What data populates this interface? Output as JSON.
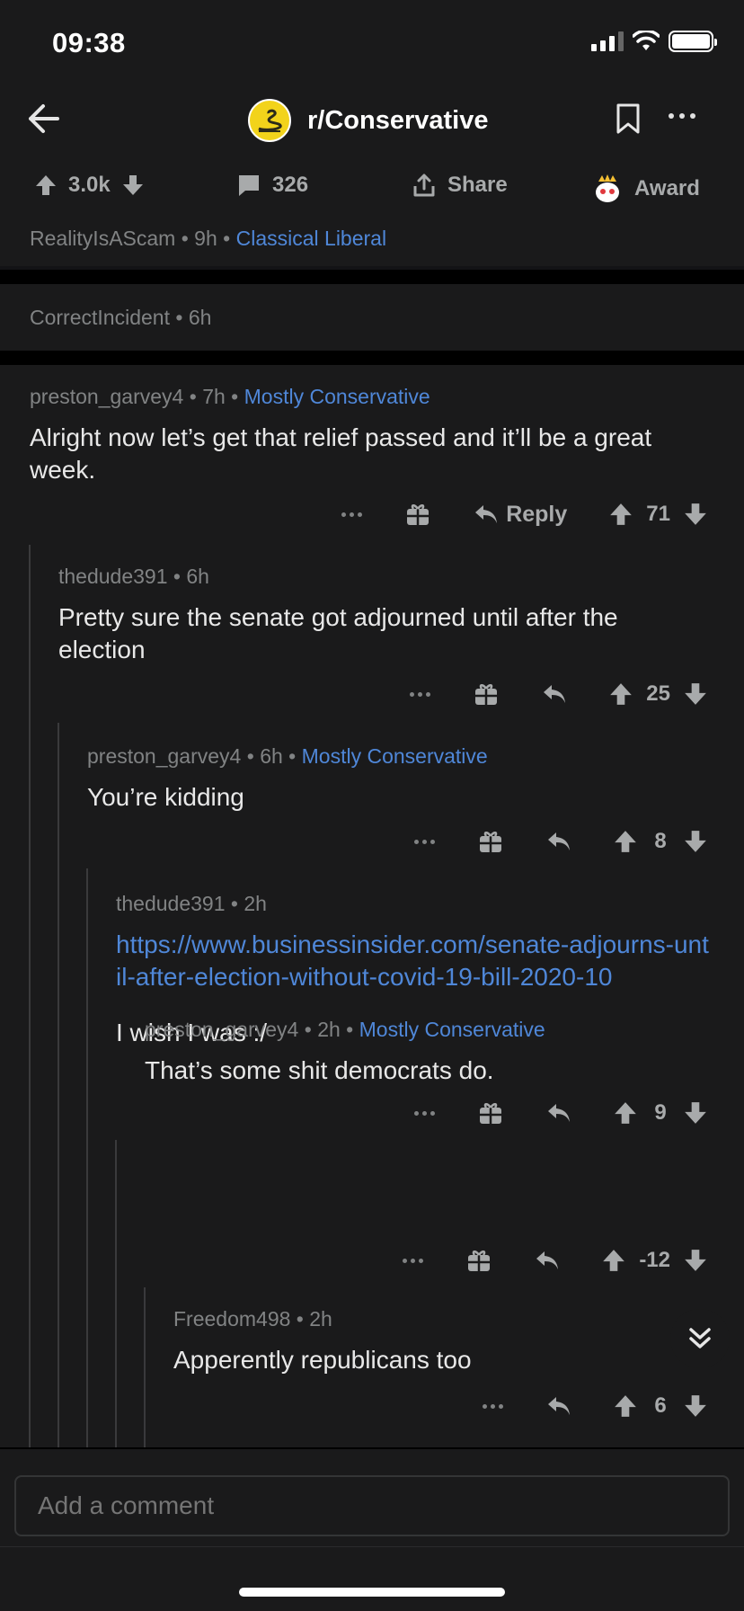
{
  "status_bar": {
    "time": "09:38"
  },
  "header": {
    "subreddit": "r/Conservative"
  },
  "post": {
    "upvotes": "3.0k",
    "comments": "326",
    "share_label": "Share",
    "award_label": "Award",
    "author": "RealityIsAScam",
    "age": "9h",
    "flair": "Classical Liberal"
  },
  "collapsed_comment": {
    "author": "CorrectIncident",
    "age": "6h"
  },
  "comments": [
    {
      "author": "preston_garvey4",
      "age": "7h",
      "flair": "Mostly Conservative",
      "body": "Alright now let’s get that relief passed and it’ll be a great week.",
      "reply_label": "Reply",
      "score": "71"
    },
    {
      "author": "thedude391",
      "age": "6h",
      "body": "Pretty sure the senate got adjourned until after the election",
      "score": "25"
    },
    {
      "author": "preston_garvey4",
      "age": "6h",
      "flair": "Mostly Conservative",
      "body": "You’re kidding",
      "score": "8"
    },
    {
      "author": "thedude391",
      "age": "2h",
      "link": "https://www.businessinsider.com/senate-adjourns-until-after-election-without-covid-19-bill-2020-10",
      "body": "I wish I was :/",
      "score": "9"
    },
    {
      "author": "preston_garvey4",
      "age": "2h",
      "flair": "Mostly Conservative",
      "body": "That’s some shit democrats do.",
      "score": "-12"
    },
    {
      "author": "Freedom498",
      "age": "2h",
      "body": "Apperently republicans too",
      "score": "6"
    }
  ],
  "composer": {
    "placeholder": "Add a comment"
  },
  "separator": " • ",
  "colors": {
    "background": "#1a1a1b",
    "flair": "#4f87d8",
    "meta": "#818384"
  }
}
